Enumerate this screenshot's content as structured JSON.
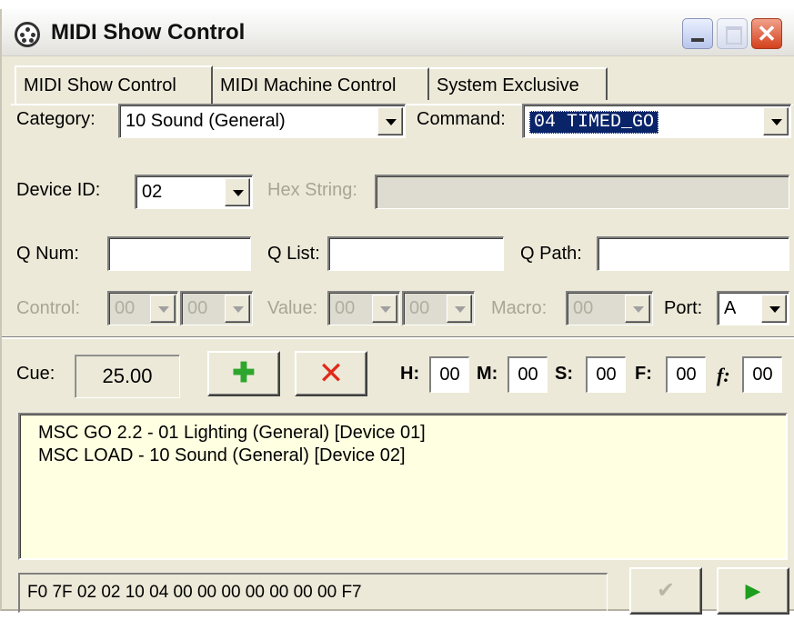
{
  "window": {
    "title": "MIDI Show Control",
    "close_glyph": "✕"
  },
  "tabs": [
    {
      "label": "MIDI Show Control",
      "active": true
    },
    {
      "label": "MIDI Machine Control",
      "active": false
    },
    {
      "label": "System Exclusive",
      "active": false
    }
  ],
  "form": {
    "category_label": "Category:",
    "category_value": "10  Sound (General)",
    "command_label": "Command:",
    "command_value": "04  TIMED_GO",
    "device_id_label": "Device ID:",
    "device_id_value": "02",
    "hex_string_label": "Hex String:",
    "hex_string_value": "",
    "q_num_label": "Q Num:",
    "q_num_value": "",
    "q_list_label": "Q List:",
    "q_list_value": "",
    "q_path_label": "Q Path:",
    "q_path_value": "",
    "control_label": "Control:",
    "control_value_1": "00",
    "control_value_2": "00",
    "value_label": "Value:",
    "value_value_1": "00",
    "value_value_2": "00",
    "macro_label": "Macro:",
    "macro_value": "00",
    "port_label": "Port:",
    "port_value": "A"
  },
  "cue": {
    "label": "Cue:",
    "value": "25.00",
    "add_icon": "plus-icon",
    "delete_icon": "x-icon",
    "add_glyph": "✚",
    "delete_glyph": "✕"
  },
  "timecode": {
    "h_label": "H:",
    "h_value": "00",
    "m_label": "M:",
    "m_value": "00",
    "s_label": "S:",
    "s_value": "00",
    "f_label": "F:",
    "f_value": "00",
    "ff_label": "f:",
    "ff_value": "00"
  },
  "log": [
    "MSC GO 2.2 - 01  Lighting (General)  [Device 01]",
    "MSC LOAD - 10  Sound (General)  [Device 02]"
  ],
  "output": {
    "hex": "F0 7F 02 02 10 04 00 00 00 00 00 00 00 F7",
    "check_glyph": "✔",
    "play_glyph": "▶"
  },
  "colors": {
    "selection": "#0a246a",
    "plus_green": "#2da62d",
    "delete_red": "#e02a1a",
    "log_background": "#ffffe1",
    "play_green": "#1e9e1e"
  }
}
